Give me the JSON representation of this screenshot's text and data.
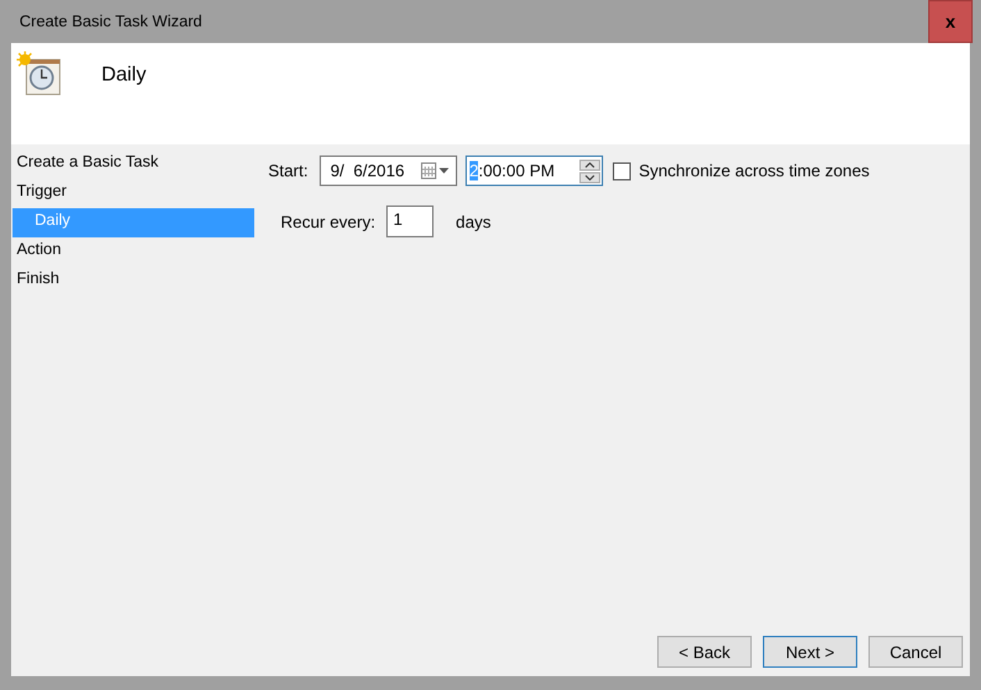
{
  "window": {
    "title": "Create Basic Task Wizard",
    "close": "x"
  },
  "header": {
    "title": "Daily"
  },
  "steps": [
    {
      "label": "Create a Basic Task",
      "selected": false
    },
    {
      "label": "Trigger",
      "selected": false,
      "children": [
        {
          "label": "Daily",
          "selected": true
        }
      ]
    },
    {
      "label": "Action",
      "selected": false
    },
    {
      "label": "Finish",
      "selected": false
    }
  ],
  "start": {
    "label": "Start:",
    "date": "9/  6/2016",
    "time_selected": "2",
    "time_rest": ":00:00 PM",
    "sync_label": "Synchronize across time zones",
    "sync_checked": false
  },
  "recur": {
    "label": "Recur every:",
    "value": "1",
    "unit": "days"
  },
  "buttons": [
    {
      "label": "< Back",
      "default": false
    },
    {
      "label": "Next >",
      "default": true
    },
    {
      "label": "Cancel",
      "default": false
    }
  ]
}
